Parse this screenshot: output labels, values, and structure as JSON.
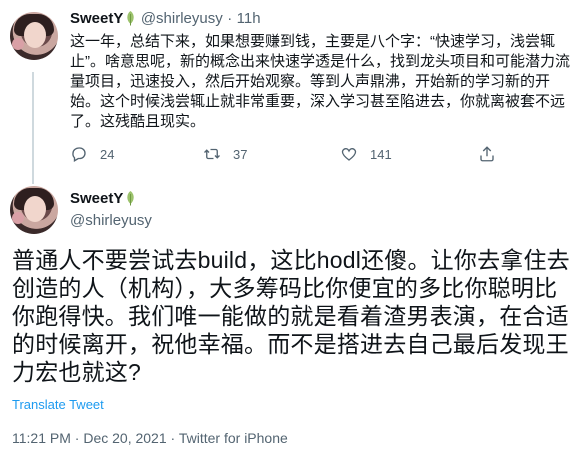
{
  "tweet1": {
    "display_name": "SweetY",
    "handle": "@shirleyusy",
    "separator": "·",
    "time": "11h",
    "body": "这一年，总结下来，如果想要赚到钱，主要是八个字：“快速学习，浅尝辄止”。啥意思呢，新的概念出来快速学透是什么，找到龙头项目和可能潜力流量项目，迅速投入，然后开始观察。等到人声鼎沸，开始新的学习新的开始。这个时候浅尝辄止就非常重要，深入学习甚至陷进去，你就离被套不远了。这残酷且现实。",
    "actions": {
      "reply_icon": "comment-icon",
      "reply_count": "24",
      "retweet_icon": "retweet-icon",
      "retweet_count": "37",
      "like_icon": "heart-icon",
      "like_count": "141",
      "share_icon": "share-icon"
    }
  },
  "tweet2": {
    "display_name": "SweetY",
    "handle": "@shirleyusy",
    "body": "普通人不要尝试去build，这比hodl还傻。让你去拿住去创造的人（机构），大多筹码比你便宜的多比你聪明比你跑得快。我们唯一能做的就是看着渣男表演，在合适的时候离开，祝他幸福。而不是搭进去自己最后发现王力宏也就这?",
    "translate_label": "Translate Tweet",
    "time": "11:21 PM",
    "separator": "·",
    "date": "Dec 20, 2021",
    "source": "Twitter for iPhone"
  },
  "colors": {
    "text": "#0f1419",
    "muted": "#536471",
    "link": "#1d9bf0",
    "leaf": "#9bc26b",
    "thread": "#cfd9de"
  }
}
